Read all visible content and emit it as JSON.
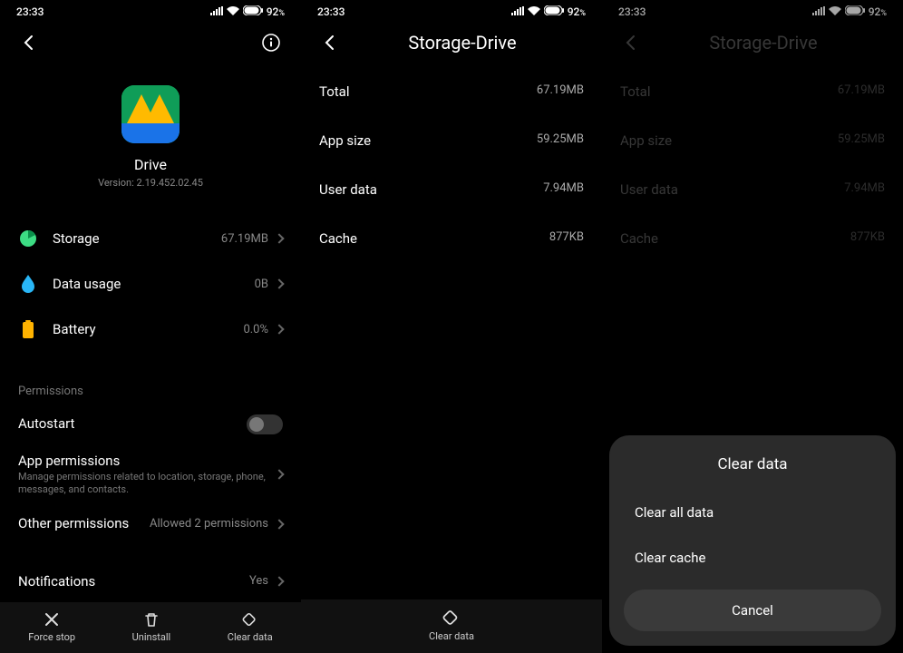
{
  "status": {
    "time": "23:33",
    "battery_pct": "92",
    "battery_suffix": "%"
  },
  "screen1": {
    "app_name": "Drive",
    "app_version": "Version: 2.19.452.02.45",
    "rows": {
      "storage": {
        "label": "Storage",
        "value": "67.19MB"
      },
      "data": {
        "label": "Data usage",
        "value": "0B"
      },
      "battery": {
        "label": "Battery",
        "value": "0.0%"
      }
    },
    "permissions_label": "Permissions",
    "autostart_label": "Autostart",
    "app_perm_title": "App permissions",
    "app_perm_sub": "Manage permissions related to location, storage, phone, messages, and contacts.",
    "other_perm_title": "Other permissions",
    "other_perm_value": "Allowed 2 permissions",
    "notifications_label": "Notifications",
    "notifications_value": "Yes",
    "bottom": {
      "force_stop": "Force stop",
      "uninstall": "Uninstall",
      "clear_data": "Clear data"
    }
  },
  "screen2": {
    "title": "Storage-Drive",
    "rows": {
      "total": {
        "label": "Total",
        "value": "67.19MB"
      },
      "app_size": {
        "label": "App size",
        "value": "59.25MB"
      },
      "user": {
        "label": "User data",
        "value": "7.94MB"
      },
      "cache": {
        "label": "Cache",
        "value": "877KB"
      }
    },
    "bottom": {
      "clear_data": "Clear data"
    }
  },
  "screen3": {
    "title": "Storage-Drive",
    "rows": {
      "total": {
        "label": "Total",
        "value": "67.19MB"
      },
      "app_size": {
        "label": "App size",
        "value": "59.25MB"
      },
      "user": {
        "label": "User data",
        "value": "7.94MB"
      },
      "cache": {
        "label": "Cache",
        "value": "877KB"
      }
    },
    "sheet": {
      "title": "Clear data",
      "opt_all": "Clear all data",
      "opt_cache": "Clear cache",
      "cancel": "Cancel"
    }
  }
}
